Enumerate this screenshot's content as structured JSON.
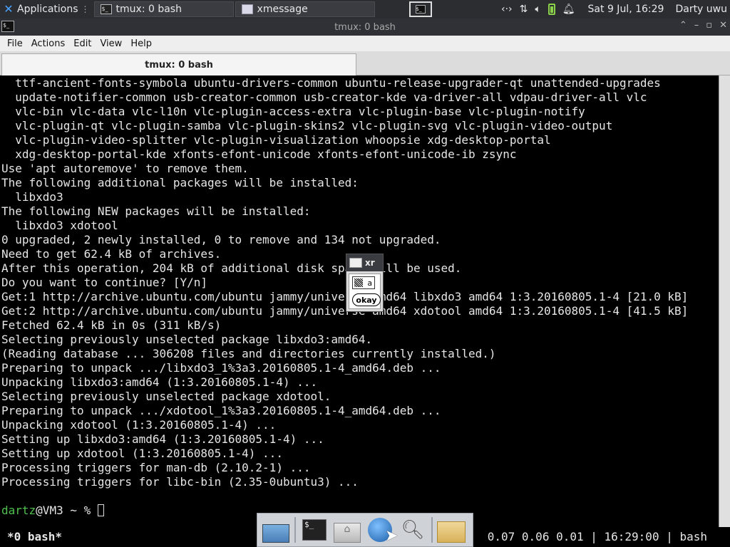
{
  "top_panel": {
    "applications_label": "Applications",
    "tasks": [
      {
        "title": "tmux: 0 bash"
      },
      {
        "title": "xmessage"
      }
    ],
    "clock": "Sat  9 Jul, 16:29",
    "user": "Darty uwu"
  },
  "window": {
    "title": "tmux: 0 bash",
    "menu": [
      "File",
      "Actions",
      "Edit",
      "View",
      "Help"
    ],
    "tab_title": "tmux: 0 bash"
  },
  "terminal": {
    "lines": [
      "  ttf-ancient-fonts-symbola ubuntu-drivers-common ubuntu-release-upgrader-qt unattended-upgrades",
      "  update-notifier-common usb-creator-common usb-creator-kde va-driver-all vdpau-driver-all vlc",
      "  vlc-bin vlc-data vlc-l10n vlc-plugin-access-extra vlc-plugin-base vlc-plugin-notify",
      "  vlc-plugin-qt vlc-plugin-samba vlc-plugin-skins2 vlc-plugin-svg vlc-plugin-video-output",
      "  vlc-plugin-video-splitter vlc-plugin-visualization whoopsie xdg-desktop-portal",
      "  xdg-desktop-portal-kde xfonts-efont-unicode xfonts-efont-unicode-ib zsync",
      "Use 'apt autoremove' to remove them.",
      "The following additional packages will be installed:",
      "  libxdo3",
      "The following NEW packages will be installed:",
      "  libxdo3 xdotool",
      "0 upgraded, 2 newly installed, 0 to remove and 134 not upgraded.",
      "Need to get 62.4 kB of archives.",
      "After this operation, 204 kB of additional disk space will be used.",
      "Do you want to continue? [Y/n]",
      "Get:1 http://archive.ubuntu.com/ubuntu jammy/universe amd64 libxdo3 amd64 1:3.20160805.1-4 [21.0 kB]",
      "Get:2 http://archive.ubuntu.com/ubuntu jammy/universe amd64 xdotool amd64 1:3.20160805.1-4 [41.5 kB]",
      "Fetched 62.4 kB in 0s (311 kB/s)",
      "Selecting previously unselected package libxdo3:amd64.",
      "(Reading database ... 306208 files and directories currently installed.)",
      "Preparing to unpack .../libxdo3_1%3a3.20160805.1-4_amd64.deb ...",
      "Unpacking libxdo3:amd64 (1:3.20160805.1-4) ...",
      "Selecting previously unselected package xdotool.",
      "Preparing to unpack .../xdotool_1%3a3.20160805.1-4_amd64.deb ...",
      "Unpacking xdotool (1:3.20160805.1-4) ...",
      "Setting up libxdo3:amd64 (1:3.20160805.1-4) ...",
      "Setting up xdotool (1:3.20160805.1-4) ...",
      "Processing triggers for man-db (2.10.2-1) ...",
      "Processing triggers for libc-bin (2.35-0ubuntu3) ...",
      ""
    ],
    "prompt_user": "dartz",
    "prompt_rest": "@VM3 ~ % "
  },
  "status_line": {
    "left": "*0 bash*",
    "right": "0.07 0.06 0.01 | 16:29:00 | bash"
  },
  "xmessage": {
    "title": "xr",
    "message": "a",
    "button": "okay"
  },
  "colors": {
    "prompt_user": "#4fc14f",
    "panel_bg": "#2b2d31"
  }
}
